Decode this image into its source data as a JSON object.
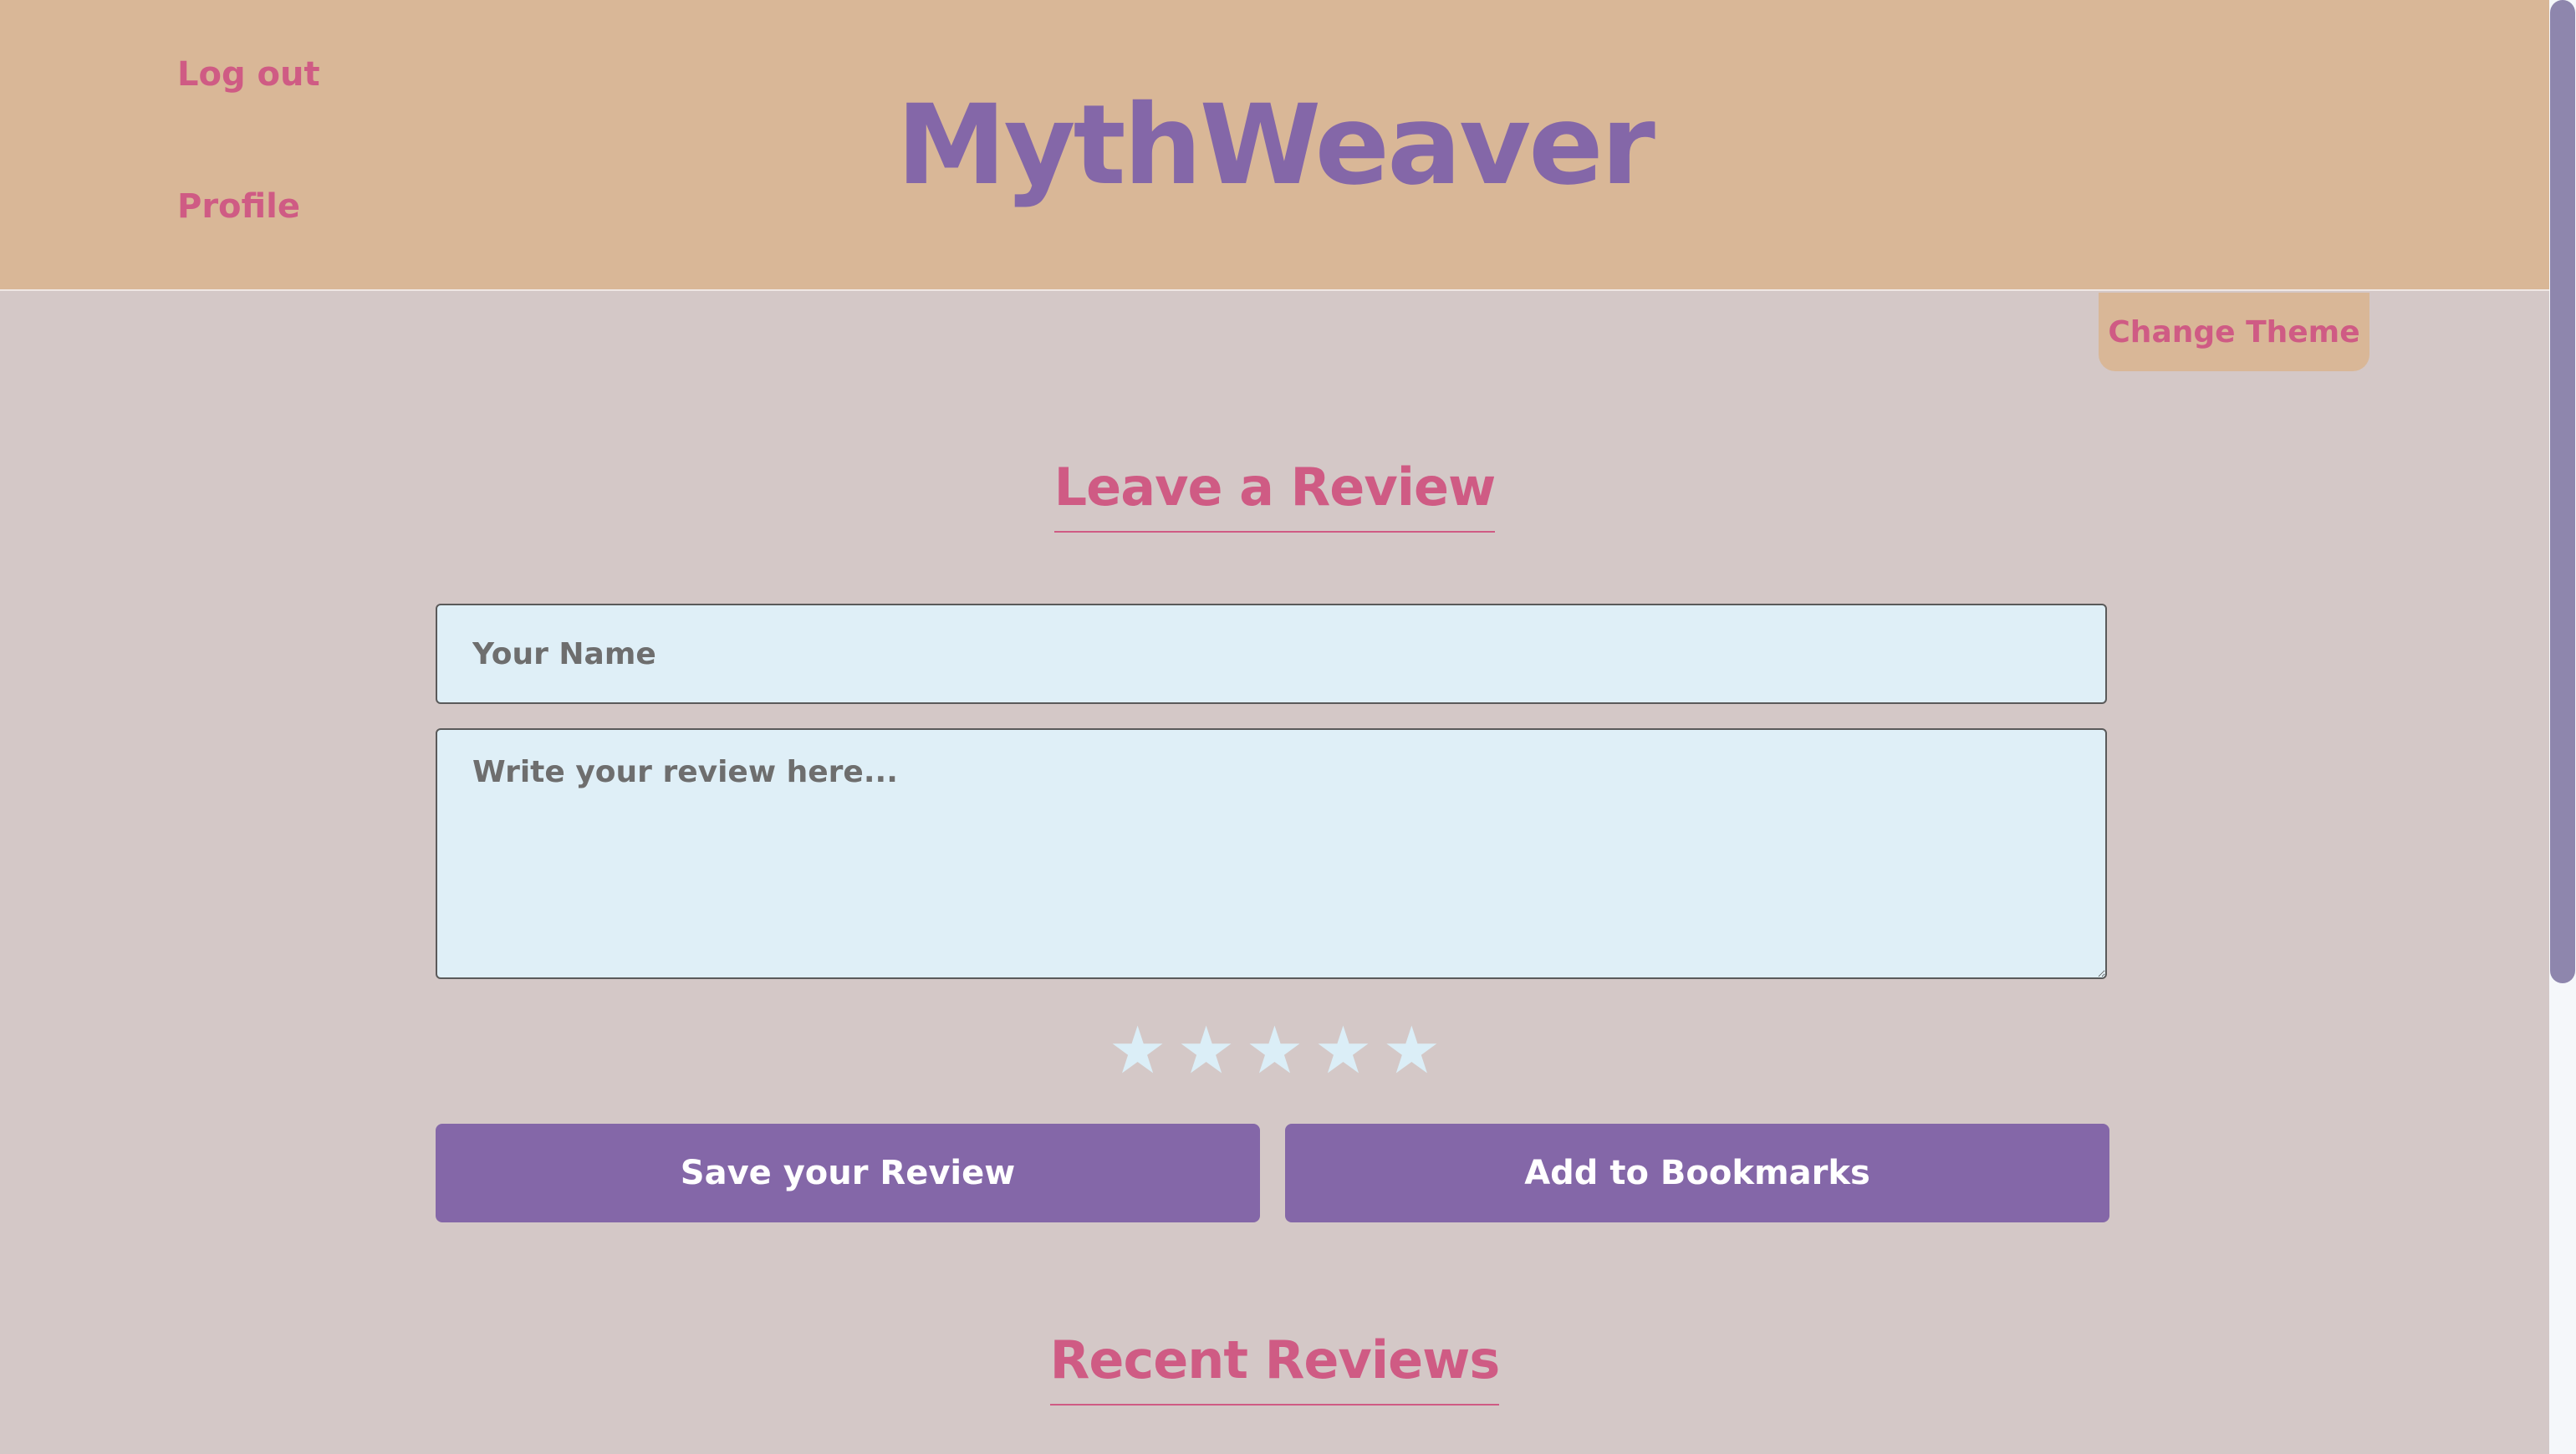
{
  "header": {
    "logo": "MythWeaver",
    "nav": [
      {
        "label": "Log out"
      },
      {
        "label": "Profile"
      }
    ],
    "change_theme": "Change Theme"
  },
  "review_form": {
    "title": "Leave a Review",
    "name_placeholder": "Your Name",
    "review_placeholder": "Write your review here...",
    "rating": {
      "stars_total": 5,
      "stars_filled": 0,
      "star_glyph": "★"
    },
    "save_button": "Save your Review",
    "bookmark_button": "Add to Bookmarks"
  },
  "recent": {
    "title": "Recent Reviews"
  },
  "colors": {
    "header_bg": "#d9b797",
    "page_bg": "#d4c8c7",
    "accent_pink": "#cf5b84",
    "accent_purple": "#8467a8",
    "input_bg": "#dfeff7"
  }
}
